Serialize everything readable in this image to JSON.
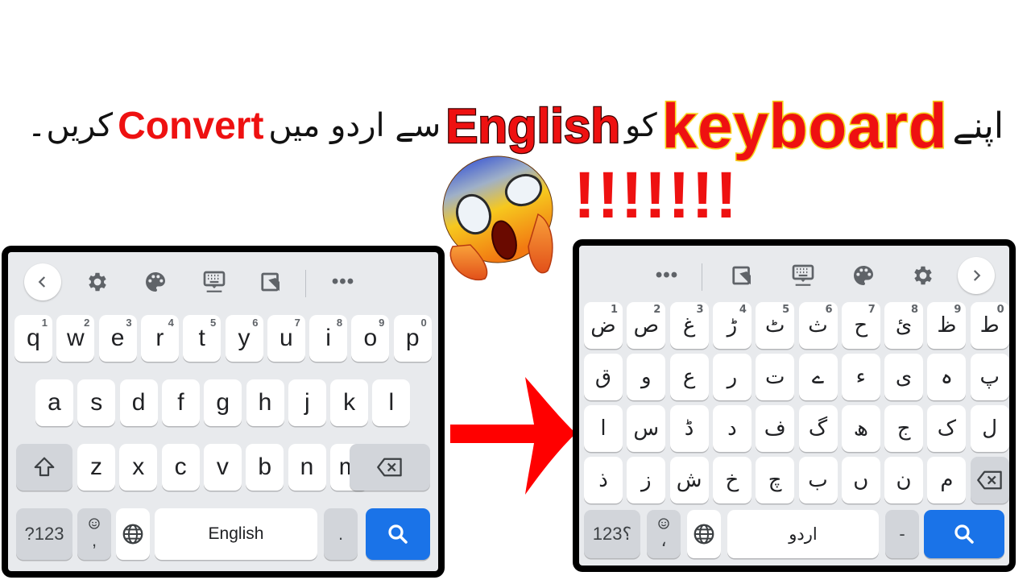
{
  "title": {
    "urdu_part1": "اپنے",
    "word_keyboard": "keyboard",
    "urdu_part2": "کو",
    "word_english": "English",
    "urdu_part3": "سے اردو میں",
    "word_convert": "Convert",
    "urdu_part4": "کریں۔",
    "exclamations": "!!!!!!!"
  },
  "emoji": "face-screaming-in-fear",
  "colors": {
    "title_red": "#ee1111",
    "title_outline_yellow": "#f5d21a",
    "keyboard_bg": "#e8eaed",
    "key_bg": "#ffffff",
    "key_gray": "#d2d5da",
    "action_blue": "#1a73e8",
    "arrow_red": "#ff0000"
  },
  "left_keyboard": {
    "language": "English",
    "toolbar": [
      "back-chevron-icon",
      "gear-icon",
      "palette-icon",
      "keyboard-icon",
      "one-handed-icon",
      "more-icon"
    ],
    "rows": [
      [
        {
          "k": "q",
          "h": "1"
        },
        {
          "k": "w",
          "h": "2"
        },
        {
          "k": "e",
          "h": "3"
        },
        {
          "k": "r",
          "h": "4"
        },
        {
          "k": "t",
          "h": "5"
        },
        {
          "k": "y",
          "h": "6"
        },
        {
          "k": "u",
          "h": "7"
        },
        {
          "k": "i",
          "h": "8"
        },
        {
          "k": "o",
          "h": "9"
        },
        {
          "k": "p",
          "h": "0"
        }
      ],
      [
        {
          "k": "a"
        },
        {
          "k": "s"
        },
        {
          "k": "d"
        },
        {
          "k": "f"
        },
        {
          "k": "g"
        },
        {
          "k": "h"
        },
        {
          "k": "j"
        },
        {
          "k": "k"
        },
        {
          "k": "l"
        }
      ],
      [
        {
          "k": "z"
        },
        {
          "k": "x"
        },
        {
          "k": "c"
        },
        {
          "k": "v"
        },
        {
          "k": "b"
        },
        {
          "k": "n"
        },
        {
          "k": "m"
        }
      ]
    ],
    "symbols_label": "?123",
    "comma_label": ",",
    "space_label": "English",
    "period_label": "."
  },
  "right_keyboard": {
    "language": "اردو",
    "toolbar": [
      "more-icon",
      "one-handed-icon",
      "keyboard-icon",
      "palette-icon",
      "gear-icon",
      "forward-chevron-icon"
    ],
    "rows": [
      [
        {
          "k": "ض",
          "h": "1"
        },
        {
          "k": "ص",
          "h": "2"
        },
        {
          "k": "غ",
          "h": "3"
        },
        {
          "k": "ڑ",
          "h": "4"
        },
        {
          "k": "ٹ",
          "h": "5"
        },
        {
          "k": "ث",
          "h": "6"
        },
        {
          "k": "ح",
          "h": "7"
        },
        {
          "k": "ئ",
          "h": "8"
        },
        {
          "k": "ظ",
          "h": "9"
        },
        {
          "k": "ط",
          "h": "0"
        }
      ],
      [
        {
          "k": "ق"
        },
        {
          "k": "و"
        },
        {
          "k": "ع"
        },
        {
          "k": "ر"
        },
        {
          "k": "ت"
        },
        {
          "k": "ے"
        },
        {
          "k": "ء"
        },
        {
          "k": "ی"
        },
        {
          "k": "ہ"
        },
        {
          "k": "پ"
        }
      ],
      [
        {
          "k": "ا"
        },
        {
          "k": "س"
        },
        {
          "k": "ڈ"
        },
        {
          "k": "د"
        },
        {
          "k": "ف"
        },
        {
          "k": "گ"
        },
        {
          "k": "ھ"
        },
        {
          "k": "ج"
        },
        {
          "k": "ک"
        },
        {
          "k": "ل"
        }
      ],
      [
        {
          "k": "ذ"
        },
        {
          "k": "ز"
        },
        {
          "k": "ش"
        },
        {
          "k": "خ"
        },
        {
          "k": "چ"
        },
        {
          "k": "ب"
        },
        {
          "k": "ں"
        },
        {
          "k": "ن"
        },
        {
          "k": "م"
        }
      ]
    ],
    "symbols_label": "؟123",
    "comma_label": "،",
    "space_label": "اردو",
    "period_label": "-"
  }
}
